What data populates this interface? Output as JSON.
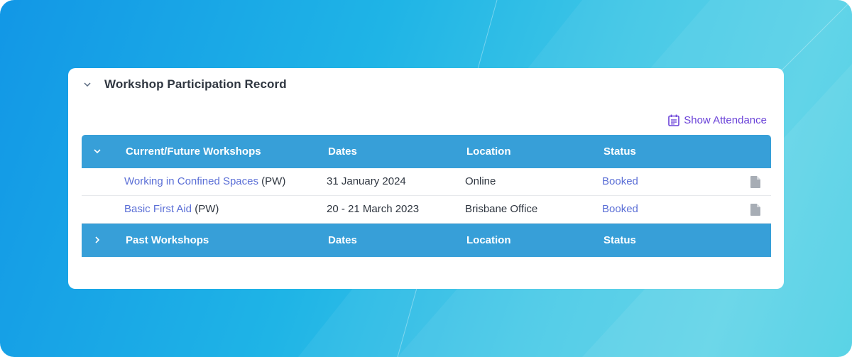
{
  "card": {
    "title": "Workshop Participation Record"
  },
  "actions": {
    "show_attendance": "Show Attendance",
    "show_attendance_icon": "calendar-list-icon"
  },
  "current_table": {
    "headers": {
      "section": "Current/Future Workshops",
      "dates": "Dates",
      "location": "Location",
      "status": "Status"
    },
    "rows": [
      {
        "name": "Working in Confined Spaces",
        "suffix": " (PW)",
        "dates": "31 January 2024",
        "location": "Online",
        "status": "Booked",
        "icon": "document-icon"
      },
      {
        "name": "Basic First Aid",
        "suffix": " (PW)",
        "dates": "20 - 21 March 2023",
        "location": "Brisbane Office",
        "status": "Booked",
        "icon": "document-icon"
      }
    ]
  },
  "past_table": {
    "headers": {
      "section": "Past Workshops",
      "dates": "Dates",
      "location": "Location",
      "status": "Status"
    }
  },
  "colors": {
    "header_bg": "#379fd8",
    "link": "#5b6fd6",
    "accent": "#6a42d8"
  }
}
